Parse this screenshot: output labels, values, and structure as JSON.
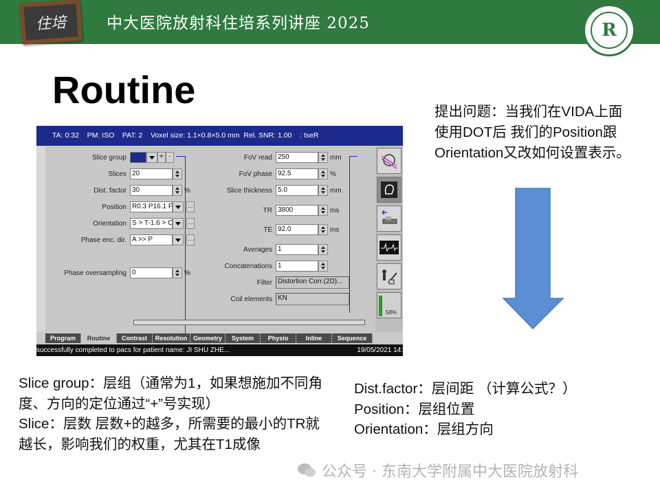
{
  "header": {
    "badge_text": "住培",
    "title": "中大医院放射科住培系列讲座 2025",
    "logo_letter": "R"
  },
  "heading": "Routine",
  "screenshot": {
    "topbar": "TA: 0:32    PM: ISO    PAT: 2    Voxel size: 1.1×0.8×5.0 mm  Rel. SNR: 1.00    : tseR",
    "left_fields": [
      {
        "label": "Slice group",
        "value": "1",
        "control": "group"
      },
      {
        "label": "Slices",
        "value": "20",
        "control": "spin",
        "unit": ""
      },
      {
        "label": "Dist. factor",
        "value": "30",
        "control": "spin",
        "unit": "%"
      },
      {
        "label": "Position",
        "value": "R0.3 P16.1 F6.6",
        "control": "dropdown"
      },
      {
        "label": "Orientation",
        "value": "S > T-1.6 > C-1.",
        "control": "dropdown"
      },
      {
        "label": "Phase enc. dir.",
        "value": "A >> P",
        "control": "dropdown"
      },
      {
        "label": "Phase oversampling",
        "value": "0",
        "control": "spin",
        "unit": "%"
      }
    ],
    "right_fields": [
      {
        "label": "FoV read",
        "value": "250",
        "unit": "mm"
      },
      {
        "label": "FoV phase",
        "value": "92.5",
        "unit": "%"
      },
      {
        "label": "Slice thickness",
        "value": "5.0",
        "unit": "mm"
      },
      {
        "label": "TR",
        "value": "3800",
        "unit": "ms"
      },
      {
        "label": "TE",
        "value": "92.0",
        "unit": "ms"
      },
      {
        "label": "Averages",
        "value": "1",
        "unit": ""
      },
      {
        "label": "Concatenations",
        "value": "1",
        "unit": ""
      },
      {
        "label": "Filter",
        "value": "Distortion Corr.(2D)...",
        "unit": ""
      },
      {
        "label": "Coil elements",
        "value": "KN",
        "unit": ""
      }
    ],
    "side_percent": "58%",
    "tabs": [
      "Program",
      "Routine",
      "Contrast",
      "Resolution",
      "Geometry",
      "System",
      "Physio",
      "Inline",
      "Sequence"
    ],
    "active_tab": "Routine",
    "status_message": "successfully completed to pacs for patient name: JI SHU ZHE...",
    "status_date": "19/05/2021 14:"
  },
  "question_text": "提出问题：当我们在VIDA上面使用DOT后 我们的Position跟Orientation又改如何设置表示。",
  "arrow_color": "#5b8fd4",
  "notes_left": [
    "Slice group：层组（通常为1，如果想施加不同角度、方向的定位通过“+”号实现）",
    "Slice：层数   层数+的越多，所需要的最小的TR就越长，影响我们的权重，尤其在T1成像"
  ],
  "notes_right": [
    "Dist.factor：层间距  （计算公式？）",
    "Position：层组位置",
    "Orientation：层组方向"
  ],
  "watermark": "公众号 · 东南大学附属中大医院放射科",
  "colors": {
    "header_bg": "#2f7a3e",
    "topbar_bg": "#1c2a8c",
    "guide_line": "#1a2fb0"
  }
}
